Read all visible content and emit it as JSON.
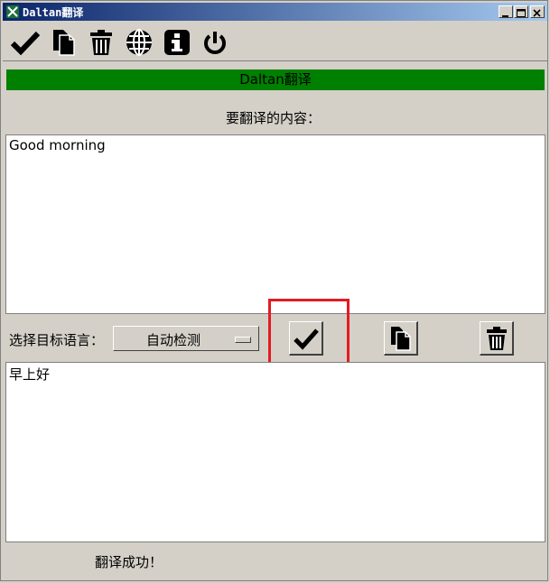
{
  "window": {
    "title": "Daltan翻译"
  },
  "toolbar": {
    "icons": [
      "check-icon",
      "copy-icon",
      "trash-icon",
      "globe-icon",
      "info-icon",
      "power-icon"
    ]
  },
  "banner": {
    "text": "Daltan翻译",
    "color": "#008000"
  },
  "source": {
    "label": "要翻译的内容：",
    "text": "Good morning"
  },
  "target": {
    "label": "选择目标语言：",
    "selected_language": "自动检测"
  },
  "actions": {
    "icons": [
      "check-icon",
      "copy-icon",
      "trash-icon"
    ]
  },
  "result": {
    "text": "早上好"
  },
  "status": {
    "text": "翻译成功！"
  },
  "highlight_color": "#e31b23"
}
